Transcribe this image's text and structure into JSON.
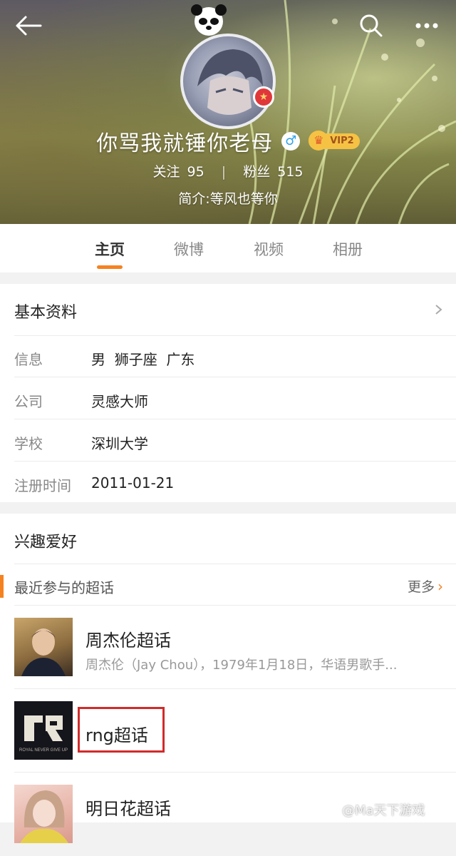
{
  "header": {
    "username": "你骂我就锤你老母",
    "gender_symbol": "♂",
    "vip_label": "VIP2",
    "stats": {
      "following_label": "关注",
      "following_count": "95",
      "separator": "|",
      "followers_label": "粉丝",
      "followers_count": "515"
    },
    "bio": "简介:等风也等你"
  },
  "tabs": [
    {
      "label": "主页",
      "active": true
    },
    {
      "label": "微博",
      "active": false
    },
    {
      "label": "视频",
      "active": false
    },
    {
      "label": "相册",
      "active": false
    }
  ],
  "basic_info": {
    "title": "基本资料",
    "rows": [
      {
        "label": "信息",
        "value": "男  狮子座  广东"
      },
      {
        "label": "公司",
        "value": "灵感大师"
      },
      {
        "label": "学校",
        "value": "深圳大学"
      },
      {
        "label": "注册时间",
        "value": "2011-01-21"
      }
    ]
  },
  "interests": {
    "title": "兴趣爱好",
    "subsection_title": "最近参与的超话",
    "more_label": "更多",
    "topics": [
      {
        "title": "周杰伦超话",
        "desc": "周杰伦（Jay Chou），1979年1月18日，华语男歌手..."
      },
      {
        "title": "rng超话",
        "desc": ""
      },
      {
        "title": "明日花超话",
        "desc": ""
      }
    ]
  },
  "rng_logo_text": "ROYAL NEVER GIVE UP",
  "watermark": "@Ma天下游戏",
  "colors": {
    "accent": "#f58220",
    "highlight_box": "#d22a2a",
    "gender_blue": "#2ea3e8",
    "vip_gold": "#f6c244"
  },
  "icons": {
    "back": "arrow-left-icon",
    "search": "search-icon",
    "more": "ellipsis-icon",
    "chevron": "chevron-right-icon",
    "weibo": "weibo-logo-icon"
  }
}
